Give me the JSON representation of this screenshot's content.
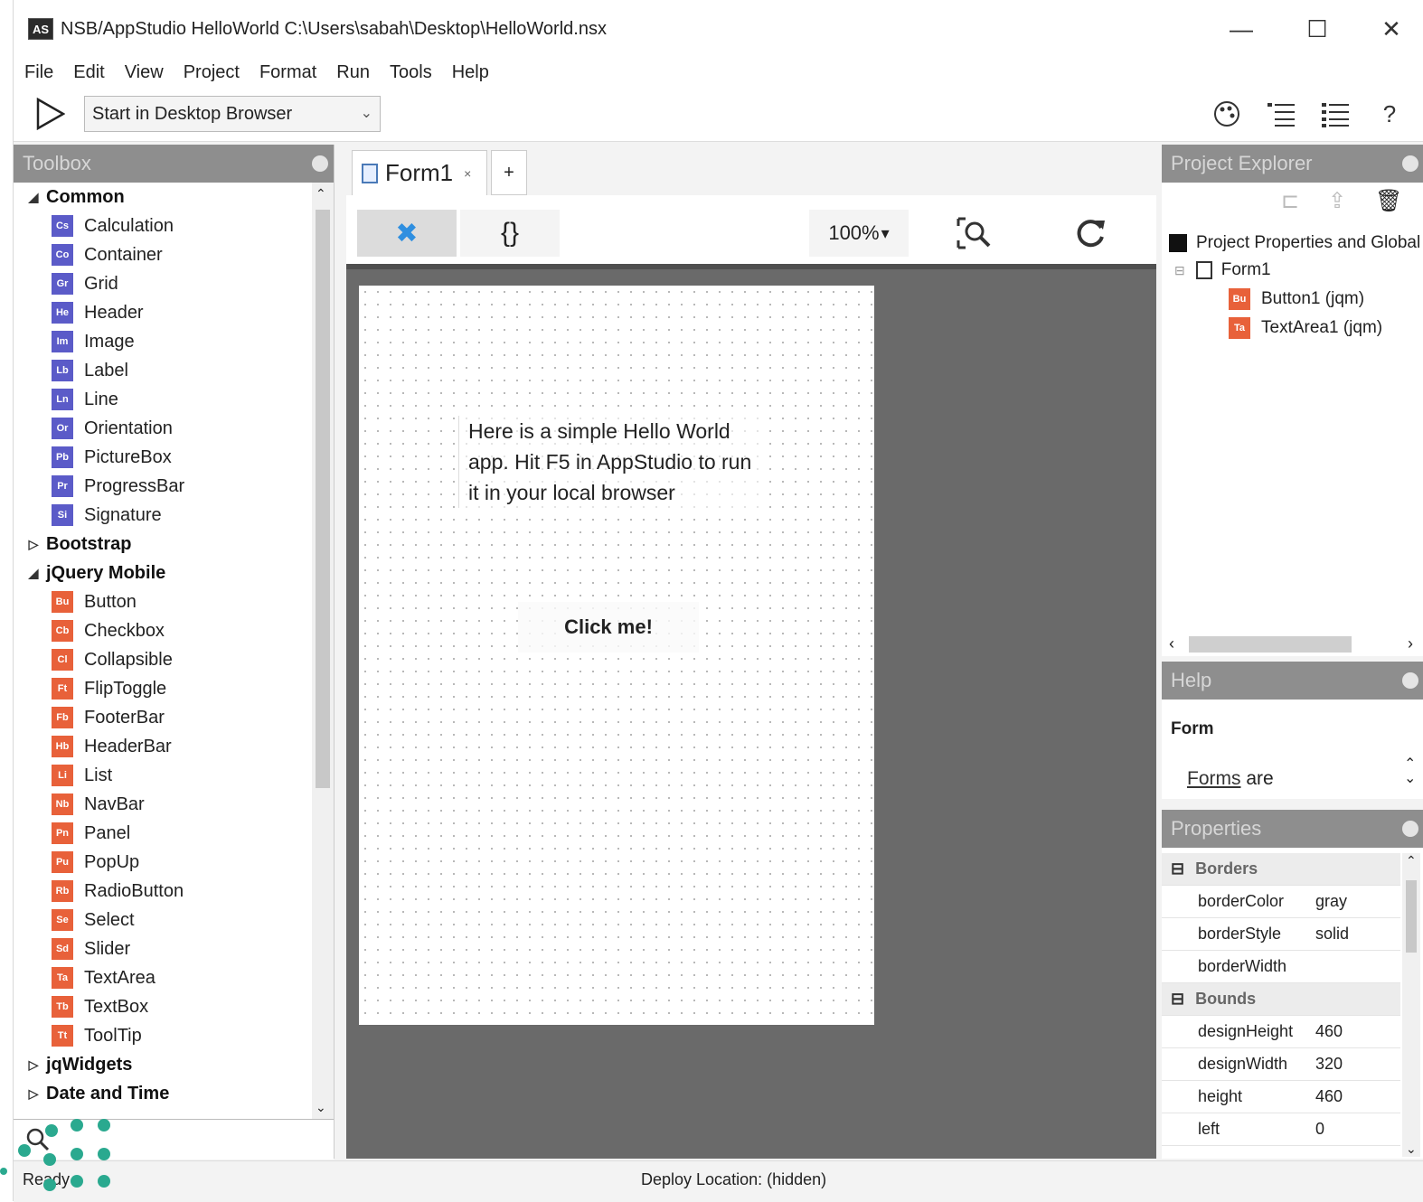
{
  "window": {
    "app_icon": "AS",
    "title": "NSB/AppStudio    HelloWorld  C:\\Users\\sabah\\Desktop\\HelloWorld.nsx",
    "minimize": "—",
    "maximize": "☐",
    "close": "✕"
  },
  "menu": [
    "File",
    "Edit",
    "View",
    "Project",
    "Format",
    "Run",
    "Tools",
    "Help"
  ],
  "toolbar": {
    "run_icon": "play-icon",
    "run_target": "Start in Desktop Browser",
    "help_label": "?"
  },
  "toolbox": {
    "title": "Toolbox",
    "categories": [
      {
        "name": "Common",
        "expanded": true,
        "color": "#5b5bc8",
        "items": [
          {
            "abbr": "Cs",
            "label": "Calculation"
          },
          {
            "abbr": "Co",
            "label": "Container"
          },
          {
            "abbr": "Gr",
            "label": "Grid"
          },
          {
            "abbr": "He",
            "label": "Header"
          },
          {
            "abbr": "Im",
            "label": "Image"
          },
          {
            "abbr": "Lb",
            "label": "Label"
          },
          {
            "abbr": "Ln",
            "label": "Line"
          },
          {
            "abbr": "Or",
            "label": "Orientation"
          },
          {
            "abbr": "Pb",
            "label": "PictureBox"
          },
          {
            "abbr": "Pr",
            "label": "ProgressBar"
          },
          {
            "abbr": "Si",
            "label": "Signature"
          }
        ]
      },
      {
        "name": "Bootstrap",
        "expanded": false,
        "items": []
      },
      {
        "name": "jQuery Mobile",
        "expanded": true,
        "color": "#e8613a",
        "items": [
          {
            "abbr": "Bu",
            "label": "Button"
          },
          {
            "abbr": "Cb",
            "label": "Checkbox"
          },
          {
            "abbr": "Cl",
            "label": "Collapsible"
          },
          {
            "abbr": "Ft",
            "label": "FlipToggle"
          },
          {
            "abbr": "Fb",
            "label": "FooterBar"
          },
          {
            "abbr": "Hb",
            "label": "HeaderBar"
          },
          {
            "abbr": "Li",
            "label": "List"
          },
          {
            "abbr": "Nb",
            "label": "NavBar"
          },
          {
            "abbr": "Pn",
            "label": "Panel"
          },
          {
            "abbr": "Pu",
            "label": "PopUp"
          },
          {
            "abbr": "Rb",
            "label": "RadioButton"
          },
          {
            "abbr": "Se",
            "label": "Select"
          },
          {
            "abbr": "Sd",
            "label": "Slider"
          },
          {
            "abbr": "Ta",
            "label": "TextArea"
          },
          {
            "abbr": "Tb",
            "label": "TextBox"
          },
          {
            "abbr": "Tt",
            "label": "ToolTip"
          }
        ]
      },
      {
        "name": "jqWidgets",
        "expanded": false,
        "items": []
      },
      {
        "name": "Date and Time",
        "expanded": false,
        "items": []
      }
    ]
  },
  "editor": {
    "tab_label": "Form1",
    "tab_close": "×",
    "tab_add": "+",
    "design_icon": "✖",
    "code_label": "{}",
    "zoom": "100%",
    "zoom_chevron": "▾",
    "form_text": "Here is a simple Hello World app. Hit F5 in AppStudio to run it in your local browser",
    "button_label": "Click me!"
  },
  "project_explorer": {
    "title": "Project Explorer",
    "tree": [
      {
        "label": "Project Properties and Global"
      },
      {
        "label": "Form1"
      },
      {
        "abbr": "Bu",
        "label": "Button1 (jqm)"
      },
      {
        "abbr": "Ta",
        "label": "TextArea1 (jqm)"
      }
    ]
  },
  "help": {
    "title": "Help",
    "heading": "Form",
    "link": "Forms",
    "text": " are"
  },
  "properties": {
    "title": "Properties",
    "rows": [
      {
        "group": "Borders"
      },
      {
        "key": "borderColor",
        "value": "gray"
      },
      {
        "key": "borderStyle",
        "value": "solid"
      },
      {
        "key": "borderWidth",
        "value": ""
      },
      {
        "group": "Bounds"
      },
      {
        "key": "designHeight",
        "value": "460"
      },
      {
        "key": "designWidth",
        "value": "320"
      },
      {
        "key": "height",
        "value": "460"
      },
      {
        "key": "left",
        "value": "0"
      }
    ]
  },
  "status": {
    "left": "Ready",
    "center": "Deploy Location: (hidden)"
  }
}
